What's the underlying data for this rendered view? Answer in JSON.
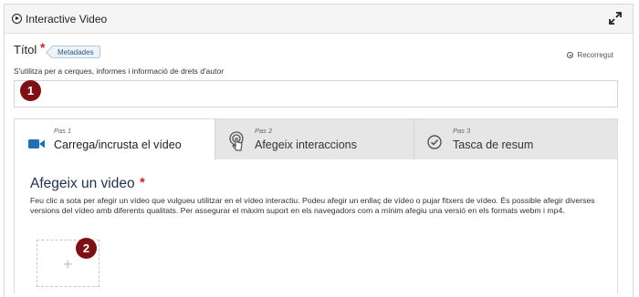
{
  "header": {
    "title": "Interactive Video"
  },
  "title_field": {
    "label": "Títol",
    "required_mark": "*",
    "metadata_button": "Metadades",
    "tour_link": "Recorregut",
    "description": "S'utilitza per a cerques, informes i informació de drets d'autor",
    "value": ""
  },
  "badges": {
    "first": "1",
    "second": "2"
  },
  "wizard": {
    "tabs": [
      {
        "step": "Pas 1",
        "label": "Carrega/incrusta el vídeo",
        "icon": "video-camera-icon",
        "active": true
      },
      {
        "step": "Pas 2",
        "label": "Afegeix interaccions",
        "icon": "touch-icon",
        "active": false
      },
      {
        "step": "Pas 3",
        "label": "Tasca de resum",
        "icon": "check-circle-icon",
        "active": false
      }
    ],
    "section_title": "Afegeix un video",
    "section_required": "*",
    "section_description": "Feu clic a sota per afegir un vídeo que vulgueu utilitzar en el vídeo interactiu. Podeu afegir un enllaç de vídeo o pujar fitxers de vídeo. És possible afegir diverses versions del vídeo amb diferents qualitats. Per assegurar el màxim suport en els navegadors com a mínim afegiu una versió en els formats webm i mp4.",
    "add_button": "+"
  },
  "colors": {
    "accent": "#1f6fb5",
    "badge": "#7d1015",
    "required": "#c1272d"
  }
}
